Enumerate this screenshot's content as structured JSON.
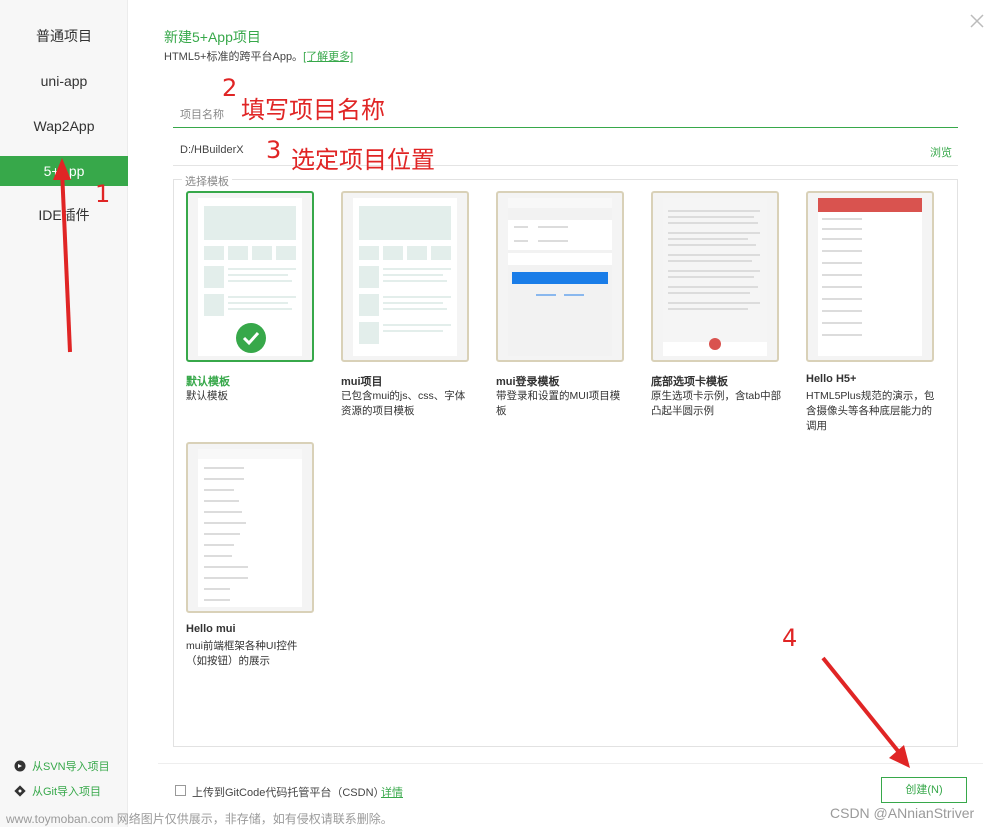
{
  "sidebar": {
    "items": [
      {
        "label": "普通项目"
      },
      {
        "label": "uni-app"
      },
      {
        "label": "Wap2App"
      },
      {
        "label": "5+App"
      },
      {
        "label": "IDE插件"
      }
    ],
    "import_svn": "从SVN导入项目",
    "import_git": "从Git导入项目"
  },
  "header": {
    "title": "新建5+App项目",
    "subtitle": "HTML5+标准的跨平台App。",
    "learn_more": "[了解更多]"
  },
  "form": {
    "name_placeholder": "项目名称",
    "location_value": "D:/HBuilderX",
    "browse": "浏览"
  },
  "templates": {
    "legend": "选择模板",
    "items": [
      {
        "name": "默认模板",
        "desc": "默认模板",
        "selected": true
      },
      {
        "name": "mui项目",
        "desc": "已包含mui的js、css、字体资源的项目模板"
      },
      {
        "name": "mui登录模板",
        "desc": "带登录和设置的MUI项目模板"
      },
      {
        "name": "底部选项卡模板",
        "desc": "原生选项卡示例，含tab中部凸起半圆示例"
      },
      {
        "name": "Hello H5+",
        "desc": "HTML5Plus规范的演示，包含摄像头等各种底层能力的调用"
      },
      {
        "name": "Hello mui",
        "desc": "mui前端框架各种UI控件（如按钮）的展示"
      }
    ]
  },
  "footer": {
    "upload_label": "上传到GitCode代码托管平台（CSDN）",
    "detail_link": "详情",
    "create_button": "创建(N)"
  },
  "annotations": {
    "n1": "1",
    "n2": "2",
    "n3": "3",
    "n4": "4",
    "label2": "填写项目名称",
    "label3": "选定项目位置"
  },
  "watermarks": {
    "left": "www.toymoban.com 网络图片仅供展示，非存储，如有侵权请联系删除。",
    "right": "CSDN @ANnianStriver"
  },
  "colors": {
    "accent": "#37a84a",
    "annotation": "#e02525"
  }
}
